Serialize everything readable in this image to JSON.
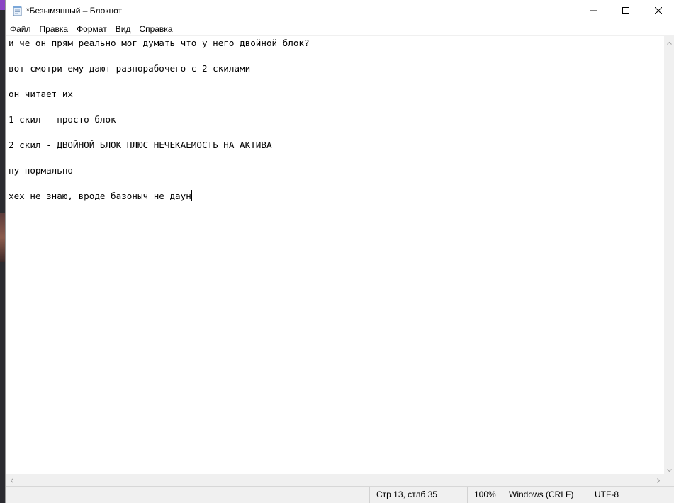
{
  "window": {
    "title": "*Безымянный – Блокнот",
    "app_icon": "notepad-icon",
    "controls": {
      "minimize_icon": "minimize-icon",
      "maximize_icon": "maximize-icon",
      "close_icon": "close-icon"
    }
  },
  "menu": {
    "items": [
      {
        "label": "Файл"
      },
      {
        "label": "Правка"
      },
      {
        "label": "Формат"
      },
      {
        "label": "Вид"
      },
      {
        "label": "Справка"
      }
    ]
  },
  "editor": {
    "lines": [
      "и че он прям реально мог думать что у него двойной блок?",
      "",
      "вот смотри ему дают разнорабочего с 2 скилами",
      "",
      "он читает их",
      "",
      "1 скил - просто блок",
      "",
      "2 скил - ДВОЙНОЙ БЛОК ПЛЮС НЕЧЕКАЕМОСТЬ НА АКТИВА",
      "",
      "ну нормально",
      "",
      "хех не знаю, вроде базоныч не даун"
    ]
  },
  "statusbar": {
    "position": "Стр 13, стлб 35",
    "zoom": "100%",
    "line_ending": "Windows (CRLF)",
    "encoding": "UTF-8"
  },
  "colors": {
    "background": "#ffffff",
    "chrome": "#f0f0f0",
    "text": "#000000"
  }
}
